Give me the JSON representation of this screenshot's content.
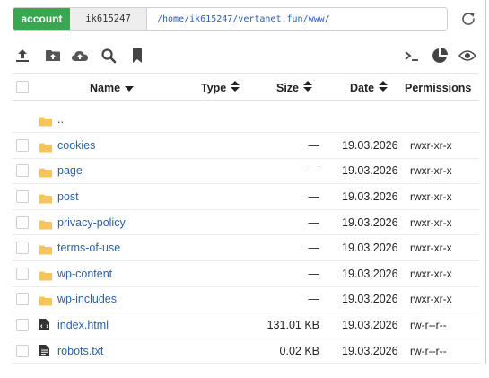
{
  "pathbar": {
    "account_label": "account",
    "user": "ik615247",
    "path": "/home/ik615247/vertanet.fun/www/"
  },
  "toolbar": {
    "left_icons": [
      "upload-icon",
      "folder-upload-icon",
      "cloud-upload-icon",
      "search-icon",
      "bookmark-icon"
    ],
    "right_icons": [
      "terminal-icon",
      "disk-usage-icon",
      "eye-icon"
    ]
  },
  "table": {
    "headers": {
      "name": "Name",
      "type": "Type",
      "size": "Size",
      "date": "Date",
      "permissions": "Permissions"
    },
    "parent_label": "..",
    "rows": [
      {
        "name": "cookies",
        "kind": "folder",
        "size": "—",
        "date": "19.03.2026",
        "permissions": "rwxr-xr-x"
      },
      {
        "name": "page",
        "kind": "folder",
        "size": "—",
        "date": "19.03.2026",
        "permissions": "rwxr-xr-x"
      },
      {
        "name": "post",
        "kind": "folder",
        "size": "—",
        "date": "19.03.2026",
        "permissions": "rwxr-xr-x"
      },
      {
        "name": "privacy-policy",
        "kind": "folder",
        "size": "—",
        "date": "19.03.2026",
        "permissions": "rwxr-xr-x"
      },
      {
        "name": "terms-of-use",
        "kind": "folder",
        "size": "—",
        "date": "19.03.2026",
        "permissions": "rwxr-xr-x"
      },
      {
        "name": "wp-content",
        "kind": "folder",
        "size": "—",
        "date": "19.03.2026",
        "permissions": "rwxr-xr-x"
      },
      {
        "name": "wp-includes",
        "kind": "folder",
        "size": "—",
        "date": "19.03.2026",
        "permissions": "rwxr-xr-x"
      },
      {
        "name": "index.html",
        "kind": "file-code",
        "size": "131.01 KB",
        "date": "19.03.2026",
        "permissions": "rw-r--r--"
      },
      {
        "name": "robots.txt",
        "kind": "file-text",
        "size": "0.02 KB",
        "date": "19.03.2026",
        "permissions": "rw-r--r--"
      }
    ]
  },
  "colors": {
    "accent": "#3aa64f",
    "link": "#2b61a8",
    "folder": "#f7c35c",
    "icon": "#444444"
  }
}
